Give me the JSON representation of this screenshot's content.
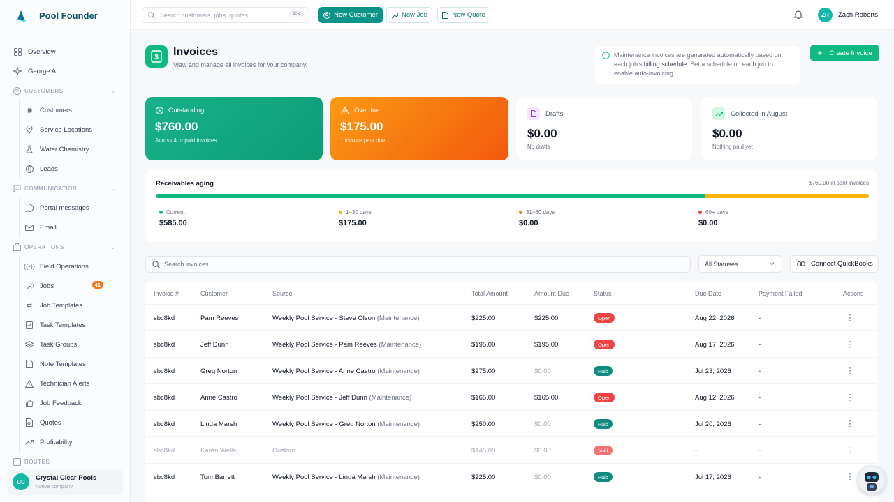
{
  "brand": {
    "name": "Pool Founder"
  },
  "sidebar": {
    "overview": "Overview",
    "george": "George AI",
    "customers_section": "CUSTOMERS",
    "customers": [
      "Customers",
      "Service Locations",
      "Water Chemistry",
      "Leads"
    ],
    "communication_section": "COMMUNICATION",
    "communication": [
      "Portal messages",
      "Email"
    ],
    "operations_section": "OPERATIONS",
    "operations": [
      "Field Operations",
      "Jobs",
      "Job Templates",
      "Task Templates",
      "Task Groups",
      "Note Templates",
      "Technician Alerts",
      "Job Feedback",
      "Quotes",
      "Profitability"
    ],
    "jobs_badge": "41",
    "routes_section": "ROUTES",
    "company_initials": "CC",
    "company_name": "Crystal Clear Pools",
    "company_status": "Active company"
  },
  "topbar": {
    "search_placeholder": "Search customers, jobs, quotes...",
    "search_shortcut": "⌘K",
    "new_customer": "New Customer",
    "new_job": "New Job",
    "new_quote": "New Quote",
    "user_initials": "ZR",
    "user_name": "Zach Roberts"
  },
  "header": {
    "title": "Invoices",
    "subtitle": "View and manage all invoices for your company.",
    "info_pre": "Maintenance invoices are generated automatically based on each job's ",
    "info_bold": "billing schedule",
    "info_post": ". Set a schedule on each job to enable auto-invoicing.",
    "create_invoice": "Create Invoice"
  },
  "stats": {
    "outstanding": {
      "title": "Outstanding",
      "value": "$760.00",
      "sub": "Across 4 unpaid invoices"
    },
    "overdue": {
      "title": "Overdue",
      "value": "$175.00",
      "sub": "1 invoice past due"
    },
    "drafts": {
      "title": "Drafts",
      "value": "$0.00",
      "sub": "No drafts"
    },
    "collected": {
      "title": "Collected in August",
      "value": "$0.00",
      "sub": "Nothing paid yet"
    }
  },
  "aging": {
    "title": "Receivables aging",
    "total": "$760.00 in sent invoices",
    "buckets": [
      {
        "label": "Current",
        "value": "$585.00",
        "amount": 585,
        "color": "#10b981"
      },
      {
        "label": "1–30 days",
        "value": "$175.00",
        "amount": 175,
        "color": "#f5b40b"
      },
      {
        "label": "31–60 days",
        "value": "$0.00",
        "amount": 0,
        "color": "#f97316"
      },
      {
        "label": "60+ days",
        "value": "$0.00",
        "amount": 0,
        "color": "#ef4444"
      }
    ]
  },
  "filters": {
    "search_placeholder": "Search invoices...",
    "status": "All Statuses",
    "connect_qb": "Connect QuickBooks"
  },
  "table": {
    "headers": [
      "Invoice #",
      "Customer",
      "Source",
      "Total Amount",
      "Amount Due",
      "Status",
      "Due Date",
      "Payment Failed",
      "Actions"
    ],
    "rows": [
      {
        "invoice": "sbc8kd",
        "customer": "Pam Reeves",
        "source": "Weekly Pool Service - Steve Olson",
        "tag": "(Maintenance)",
        "total": "$225.00",
        "due": "$225.00",
        "status": "Open",
        "status_key": "open",
        "date": "Aug 22, 2026",
        "failed": "-"
      },
      {
        "invoice": "sbc8kd",
        "customer": "Jeff Dunn",
        "source": "Weekly Pool Service - Pam Reeves",
        "tag": "(Maintenance)",
        "total": "$195.00",
        "due": "$195.00",
        "status": "Open",
        "status_key": "open",
        "date": "Aug 17, 2026",
        "failed": "-"
      },
      {
        "invoice": "sbc8kd",
        "customer": "Greg Norton",
        "source": "Weekly Pool Service - Anne Castro",
        "tag": "(Maintenance)",
        "total": "$275.00",
        "due": "$0.00",
        "status": "Paid",
        "status_key": "paid",
        "date": "Jul 23, 2026",
        "failed": "-"
      },
      {
        "invoice": "sbc8kd",
        "customer": "Anne Castro",
        "source": "Weekly Pool Service - Jeff Dunn",
        "tag": "(Maintenance)",
        "total": "$165.00",
        "due": "$165.00",
        "status": "Open",
        "status_key": "open",
        "date": "Aug 12, 2026",
        "failed": "-"
      },
      {
        "invoice": "sbc8kd",
        "customer": "Linda Marsh",
        "source": "Weekly Pool Service - Greg Norton",
        "tag": "(Maintenance)",
        "total": "$250.00",
        "due": "$0.00",
        "status": "Paid",
        "status_key": "paid",
        "date": "Jul 20, 2026",
        "failed": "-"
      },
      {
        "invoice": "sbc8kd",
        "customer": "Karen Wells",
        "source": "Custom",
        "tag": "",
        "total": "$145.00",
        "due": "$0.00",
        "status": "Void",
        "status_key": "void",
        "date": "-",
        "failed": "-"
      },
      {
        "invoice": "sbc8kd",
        "customer": "Tom Barrett",
        "source": "Weekly Pool Service - Linda Marsh",
        "tag": "(Maintenance)",
        "total": "$225.00",
        "due": "$0.00",
        "status": "Paid",
        "status_key": "paid",
        "date": "Jul 17, 2026",
        "failed": "-"
      }
    ]
  }
}
